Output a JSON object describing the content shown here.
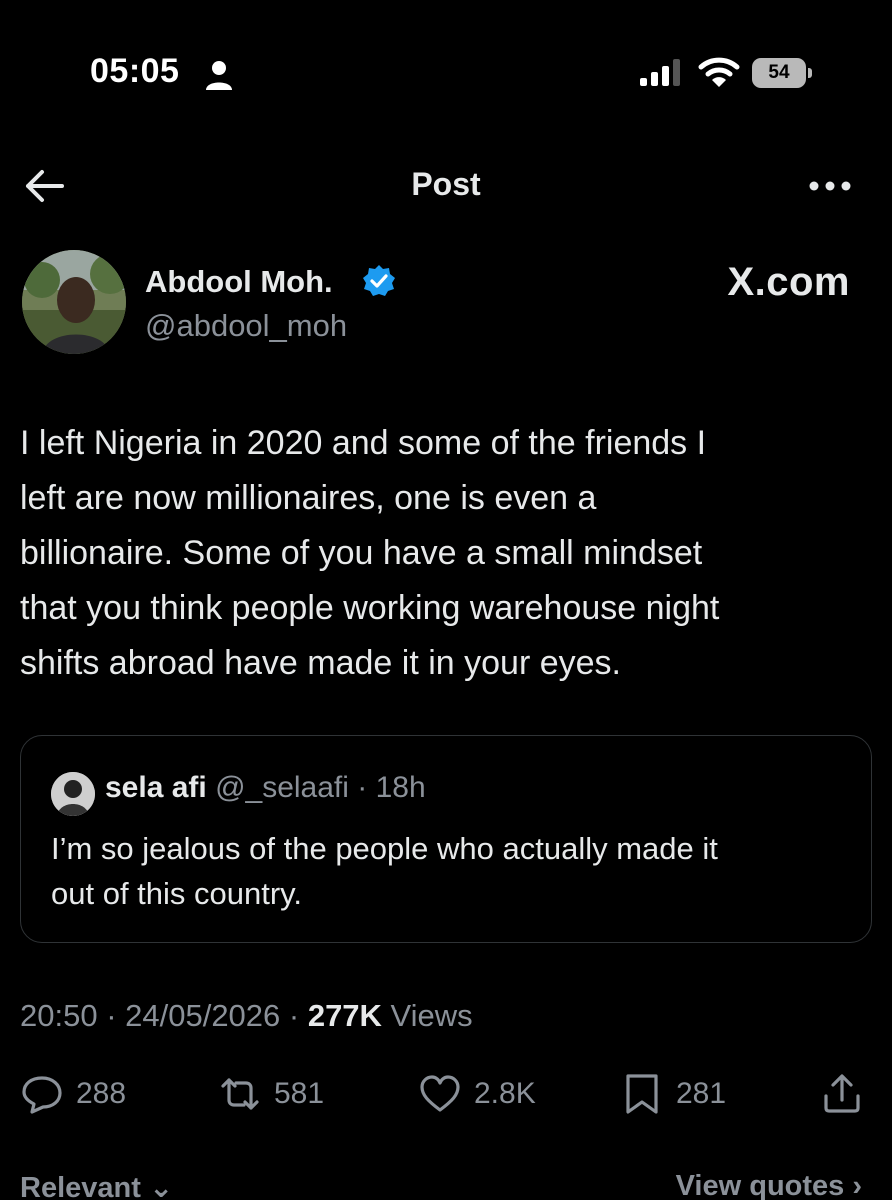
{
  "status_bar": {
    "time": "05:05",
    "battery": "54"
  },
  "header": {
    "title": "Post"
  },
  "author": {
    "name": "Abdool Moh.",
    "handle": "@abdool_moh",
    "watermark": "X.com"
  },
  "tweet": {
    "lines": [
      "I left Nigeria in 2020 and some of the friends I",
      "left are now millionaires, one is even a",
      "billionaire. Some of you have a small mindset",
      "that you think people working warehouse night",
      "shifts abroad have made it in your eyes."
    ]
  },
  "quote": {
    "name": "sela afi",
    "meta": " @_selaafi · 18h",
    "lines": [
      "I’m so jealous of the people who actually made it",
      "out of this country."
    ]
  },
  "meta": {
    "timestamp": "20:50 · 24/05/2026 · ",
    "views_count": "277K",
    "views_label": " Views"
  },
  "actions": {
    "replies": "288",
    "reposts": "581",
    "likes": "2.8K",
    "bookmarks": "281"
  },
  "bottom": {
    "relevant": "Relevant ⌄",
    "view_quotes": "View quotes ›"
  },
  "colors": {
    "background": "#000000",
    "text": "#e7e9ea",
    "muted": "#8b9199",
    "verified": "#1d9bf0",
    "border": "#2f3336"
  }
}
